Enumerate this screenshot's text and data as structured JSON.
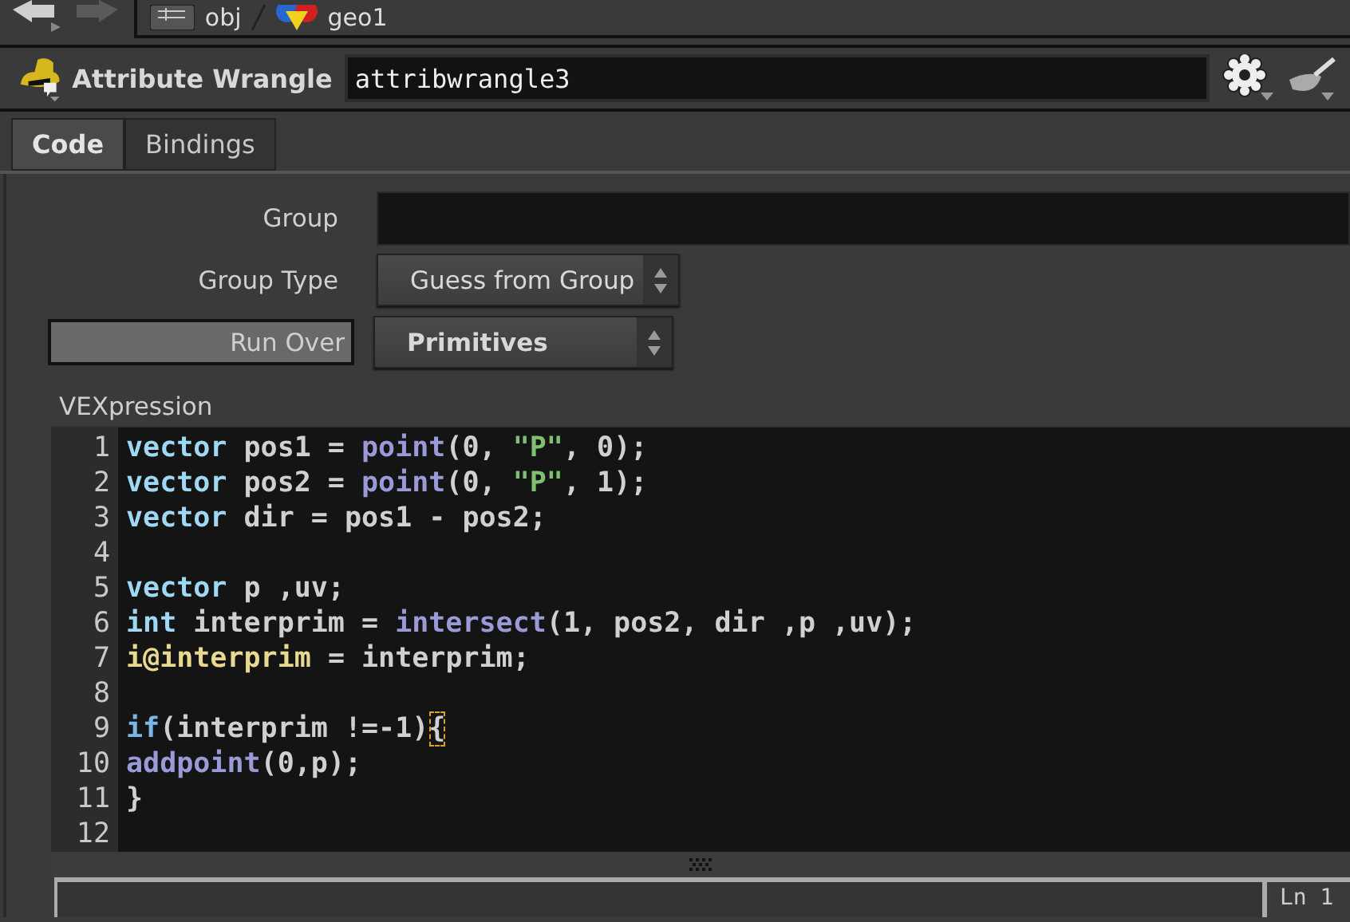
{
  "nav": {
    "path": [
      {
        "label": "obj",
        "kind": "network"
      },
      {
        "label": "geo1",
        "kind": "geometry"
      }
    ]
  },
  "node": {
    "type": "Attribute Wrangle",
    "name": "attribwrangle3"
  },
  "tabs": [
    {
      "label": "Code",
      "selected": true
    },
    {
      "label": "Bindings",
      "selected": false
    }
  ],
  "params": [
    {
      "kind": "field",
      "label": "Group"
    },
    {
      "kind": "menu",
      "label": "Group Type",
      "value": "Guess from Group"
    },
    {
      "kind": "toggle-menu",
      "label": "Run Over",
      "value": "Primitives"
    }
  ],
  "editor": {
    "label": "VEXpression",
    "lines": [
      {
        "number": "1",
        "tokens": [
          {
            "kind": "type",
            "text": "vector"
          },
          {
            "kind": "plain",
            "text": " pos1 = "
          },
          {
            "kind": "func",
            "text": "point"
          },
          {
            "kind": "plain",
            "text": "(0, "
          },
          {
            "kind": "string",
            "text": "\"P\""
          },
          {
            "kind": "plain",
            "text": ", 0);"
          }
        ]
      },
      {
        "number": "2",
        "tokens": [
          {
            "kind": "type",
            "text": "vector"
          },
          {
            "kind": "plain",
            "text": " pos2 = "
          },
          {
            "kind": "func",
            "text": "point"
          },
          {
            "kind": "plain",
            "text": "(0, "
          },
          {
            "kind": "string",
            "text": "\"P\""
          },
          {
            "kind": "plain",
            "text": ", 1);"
          }
        ]
      },
      {
        "number": "3",
        "tokens": [
          {
            "kind": "type",
            "text": "vector"
          },
          {
            "kind": "plain",
            "text": " dir = pos1 - pos2;"
          }
        ]
      },
      {
        "number": "4"
      },
      {
        "number": "5",
        "tokens": [
          {
            "kind": "type",
            "text": "vector"
          },
          {
            "kind": "plain",
            "text": " p ,uv;"
          }
        ]
      },
      {
        "number": "6",
        "tokens": [
          {
            "kind": "type",
            "text": "int"
          },
          {
            "kind": "plain",
            "text": " interprim = "
          },
          {
            "kind": "func",
            "text": "intersect"
          },
          {
            "kind": "plain",
            "text": "(1, pos2, dir ,p ,uv);"
          }
        ]
      },
      {
        "number": "7",
        "tokens": [
          {
            "kind": "attr",
            "text": "i@interprim"
          },
          {
            "kind": "plain",
            "text": " = interprim;"
          }
        ]
      },
      {
        "number": "8"
      },
      {
        "number": "9",
        "tokens": [
          {
            "kind": "keyword",
            "text": "if"
          },
          {
            "kind": "plain",
            "text": "(interprim !=-1)"
          },
          {
            "kind": "match",
            "text": "{"
          }
        ]
      },
      {
        "number": "10",
        "tokens": [
          {
            "kind": "func",
            "text": "addpoint"
          },
          {
            "kind": "plain",
            "text": "(0,p);"
          }
        ]
      },
      {
        "number": "11",
        "tokens": [
          {
            "kind": "plain",
            "text": "}"
          }
        ]
      },
      {
        "number": "12"
      }
    ]
  },
  "status": {
    "position": "Ln 1"
  }
}
